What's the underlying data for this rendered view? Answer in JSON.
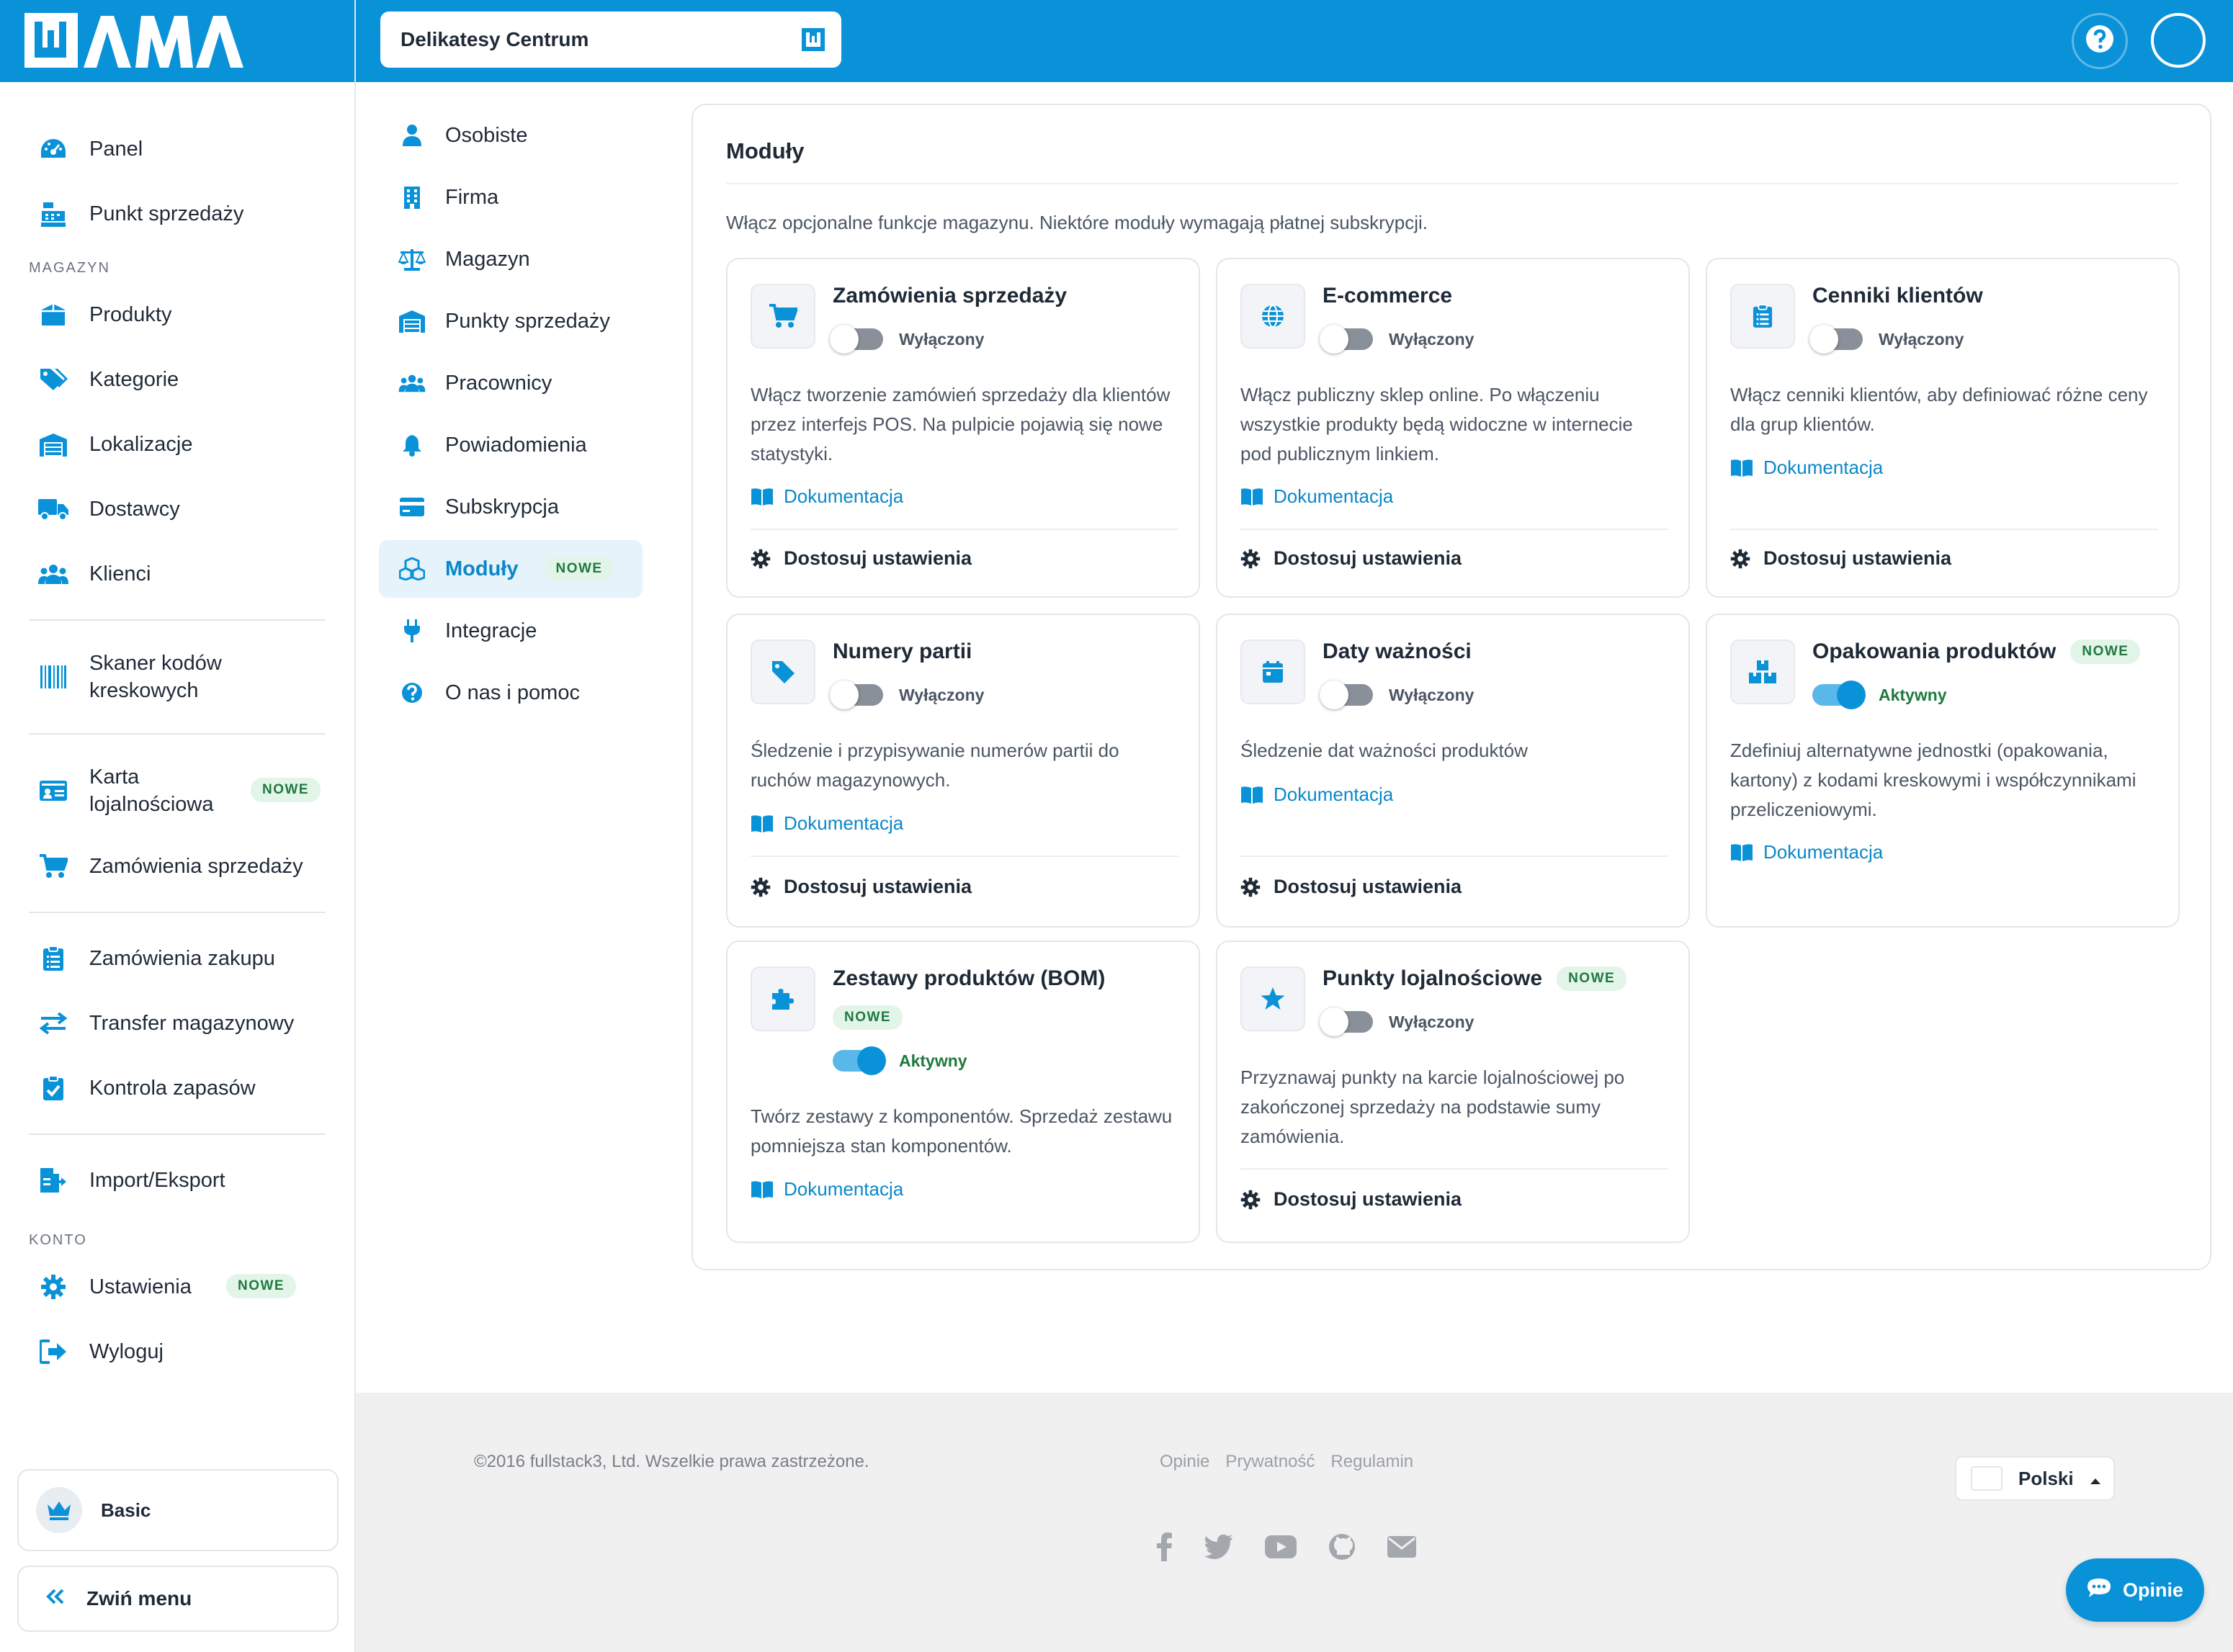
{
  "app": {
    "logo_text": "WAMA"
  },
  "colors": {
    "primary": "#0a92d9",
    "success": "#1e7a3e",
    "badge_bg": "#e3f5e9"
  },
  "header": {
    "store": "Delikatesy Centrum",
    "help_icon": "question-circle-icon",
    "profile_icon": "user-avatar-circle"
  },
  "sidebar": {
    "items_top": [
      {
        "label": "Panel",
        "icon": "dashboard-gauge-icon"
      },
      {
        "label": "Punkt sprzedaży",
        "icon": "cash-register-icon"
      }
    ],
    "section_magazyn": "MAGAZYN",
    "items_magazyn": [
      {
        "label": "Produkty",
        "icon": "box-icon"
      },
      {
        "label": "Kategorie",
        "icon": "tags-icon"
      },
      {
        "label": "Lokalizacje",
        "icon": "warehouse-icon"
      },
      {
        "label": "Dostawcy",
        "icon": "truck-icon"
      },
      {
        "label": "Klienci",
        "icon": "users-icon"
      }
    ],
    "scanner": {
      "label": "Skaner kodów kreskowych",
      "icon": "barcode-icon"
    },
    "loyalty": {
      "label": "Karta lojalnościowa",
      "icon": "id-card-icon",
      "badge": "NOWE"
    },
    "sales_orders": {
      "label": "Zamówienia sprzedaży",
      "icon": "cart-icon"
    },
    "items_ops": [
      {
        "label": "Zamówienia zakupu",
        "icon": "clipboard-list-icon"
      },
      {
        "label": "Transfer magazynowy",
        "icon": "exchange-arrows-icon"
      },
      {
        "label": "Kontrola zapasów",
        "icon": "clipboard-check-icon"
      }
    ],
    "import_export": {
      "label": "Import/Eksport",
      "icon": "file-export-icon"
    },
    "section_konto": "KONTO",
    "settings": {
      "label": "Ustawienia",
      "icon": "gear-icon",
      "badge": "NOWE"
    },
    "logout": {
      "label": "Wyloguj",
      "icon": "sign-out-icon"
    },
    "plan": {
      "label": "Basic",
      "icon": "crown-icon"
    },
    "collapse": {
      "label": "Zwiń menu",
      "icon": "double-chevron-left-icon"
    }
  },
  "settings_nav": {
    "items": [
      {
        "label": "Osobiste",
        "icon": "user-icon"
      },
      {
        "label": "Firma",
        "icon": "building-icon"
      },
      {
        "label": "Magazyn",
        "icon": "balance-scale-icon"
      },
      {
        "label": "Punkty sprzedaży",
        "icon": "store-icon"
      },
      {
        "label": "Pracownicy",
        "icon": "users-icon"
      },
      {
        "label": "Powiadomienia",
        "icon": "bell-icon"
      },
      {
        "label": "Subskrypcja",
        "icon": "credit-card-icon"
      },
      {
        "label": "Moduły",
        "icon": "cubes-icon",
        "badge": "NOWE",
        "active": true
      },
      {
        "label": "Integracje",
        "icon": "plug-icon"
      },
      {
        "label": "O nas i pomoc",
        "icon": "question-circle-icon"
      }
    ]
  },
  "modules_page": {
    "title": "Moduły",
    "description": "Włącz opcjonalne funkcje magazynu. Niektóre moduły wymagają płatnej subskrypcji.",
    "doc_label": "Dokumentacja",
    "settings_label": "Dostosuj ustawienia",
    "state_off": "Wyłączony",
    "state_on": "Aktywny",
    "badge_new": "NOWE",
    "modules": [
      {
        "title": "Zamówienia sprzedaży",
        "icon": "cart-icon",
        "enabled": false,
        "desc": "Włącz tworzenie zamówień sprzedaży dla klientów przez interfejs POS. Na pulpicie pojawią się nowe statystyki."
      },
      {
        "title": "E-commerce",
        "icon": "globe-icon",
        "enabled": false,
        "desc": "Włącz publiczny sklep online. Po włączeniu wszystkie produkty będą widoczne w internecie pod publicznym linkiem."
      },
      {
        "title": "Cenniki klientów",
        "icon": "clipboard-list-icon",
        "enabled": false,
        "desc": "Włącz cenniki klientów, aby definiować różne ceny dla grup klientów."
      },
      {
        "title": "Numery partii",
        "icon": "tag-icon",
        "enabled": false,
        "desc": "Śledzenie i przypisywanie numerów partii do ruchów magazynowych."
      },
      {
        "title": "Daty ważności",
        "icon": "calendar-icon",
        "enabled": false,
        "desc": "Śledzenie dat ważności produktów"
      },
      {
        "title": "Opakowania produktów",
        "icon": "boxes-icon",
        "enabled": true,
        "is_new": true,
        "desc": "Zdefiniuj alternatywne jednostki (opakowania, kartony) z kodami kreskowymi i współczynnikami przeliczeniowymi."
      },
      {
        "title": "Zestawy produktów (BOM)",
        "icon": "puzzle-icon",
        "enabled": true,
        "is_new": true,
        "desc": "Twórz zestawy z komponentów. Sprzedaż zestawu pomniejsza stan komponentów."
      },
      {
        "title": "Punkty lojalnościowe",
        "icon": "star-icon",
        "enabled": false,
        "is_new": true,
        "desc": "Przyznawaj punkty na karcie lojalnościowej po zakończonej sprzedaży na podstawie sumy zamówienia."
      }
    ]
  },
  "footer": {
    "copyright": "©2016 fullstack3, Ltd. Wszelkie prawa zastrzeżone.",
    "links": [
      "Opinie",
      "Prywatność",
      "Regulamin"
    ],
    "language": "Polski",
    "social_icons": [
      "facebook-icon",
      "twitter-icon",
      "youtube-icon",
      "github-icon",
      "envelope-icon"
    ]
  },
  "feedback_button": {
    "label": "Opinie",
    "icon": "comment-dots-icon"
  }
}
